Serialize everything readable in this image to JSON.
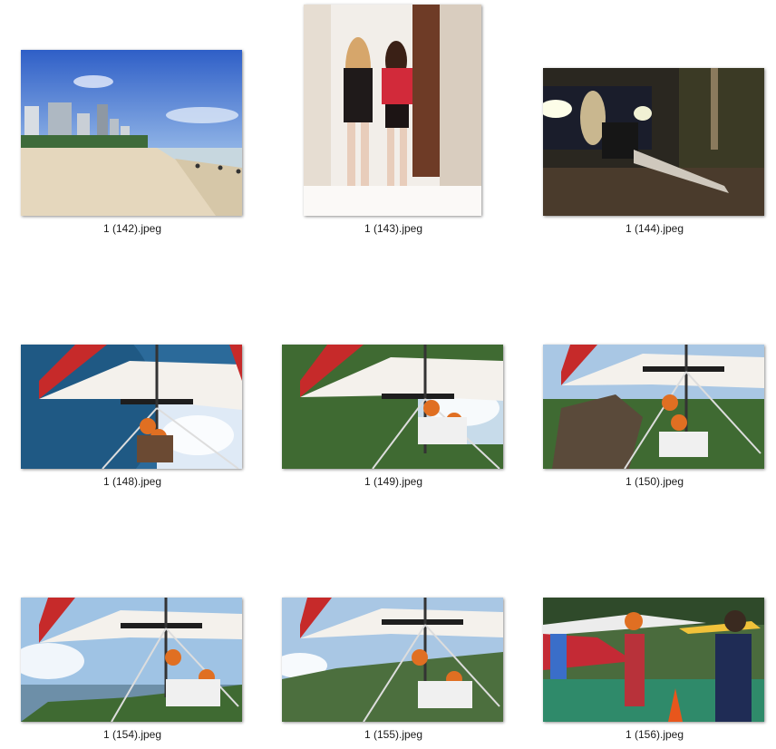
{
  "files": [
    {
      "name": "1 (142).jpeg",
      "subject": "beach-skyline"
    },
    {
      "name": "1 (143).jpeg",
      "subject": "two-women-hallway"
    },
    {
      "name": "1 (144).jpeg",
      "subject": "woman-night-car"
    },
    {
      "name": "1 (148).jpeg",
      "subject": "hang-glider-sky"
    },
    {
      "name": "1 (149).jpeg",
      "subject": "hang-glider-forest"
    },
    {
      "name": "1 (150).jpeg",
      "subject": "hang-glider-mountain"
    },
    {
      "name": "1 (154).jpeg",
      "subject": "hang-glider-coast"
    },
    {
      "name": "1 (155).jpeg",
      "subject": "hang-glider-hills"
    },
    {
      "name": "1 (156).jpeg",
      "subject": "launch-ramp-people"
    }
  ]
}
